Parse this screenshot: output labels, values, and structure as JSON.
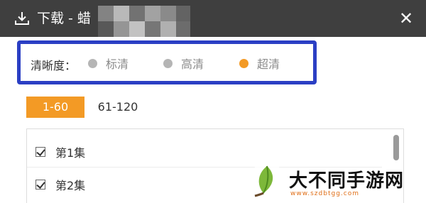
{
  "window": {
    "title": "下载 - 蜡",
    "close_glyph": "✕"
  },
  "quality": {
    "label": "清晰度：",
    "options": [
      {
        "label": "标清",
        "selected": false
      },
      {
        "label": "高清",
        "selected": false
      },
      {
        "label": "超清",
        "selected": true
      }
    ]
  },
  "ranges": {
    "tabs": [
      {
        "label": "1-60",
        "active": true
      },
      {
        "label": "61-120",
        "active": false
      }
    ]
  },
  "episodes": {
    "items": [
      {
        "label": "第1集",
        "checked": true
      },
      {
        "label": "第2集",
        "checked": true
      }
    ]
  },
  "watermark": {
    "title": "大不同手游网",
    "url": "www.szdbtgg.com"
  },
  "colors": {
    "titlebar": "#3f3f3f",
    "accent_orange": "#f39a25",
    "highlight_blue": "#2b3fc4",
    "dot_gray": "#b5b5b5"
  },
  "icons": {
    "download": "download-icon",
    "close": "close-icon",
    "logo": "leaf-logo-icon"
  }
}
